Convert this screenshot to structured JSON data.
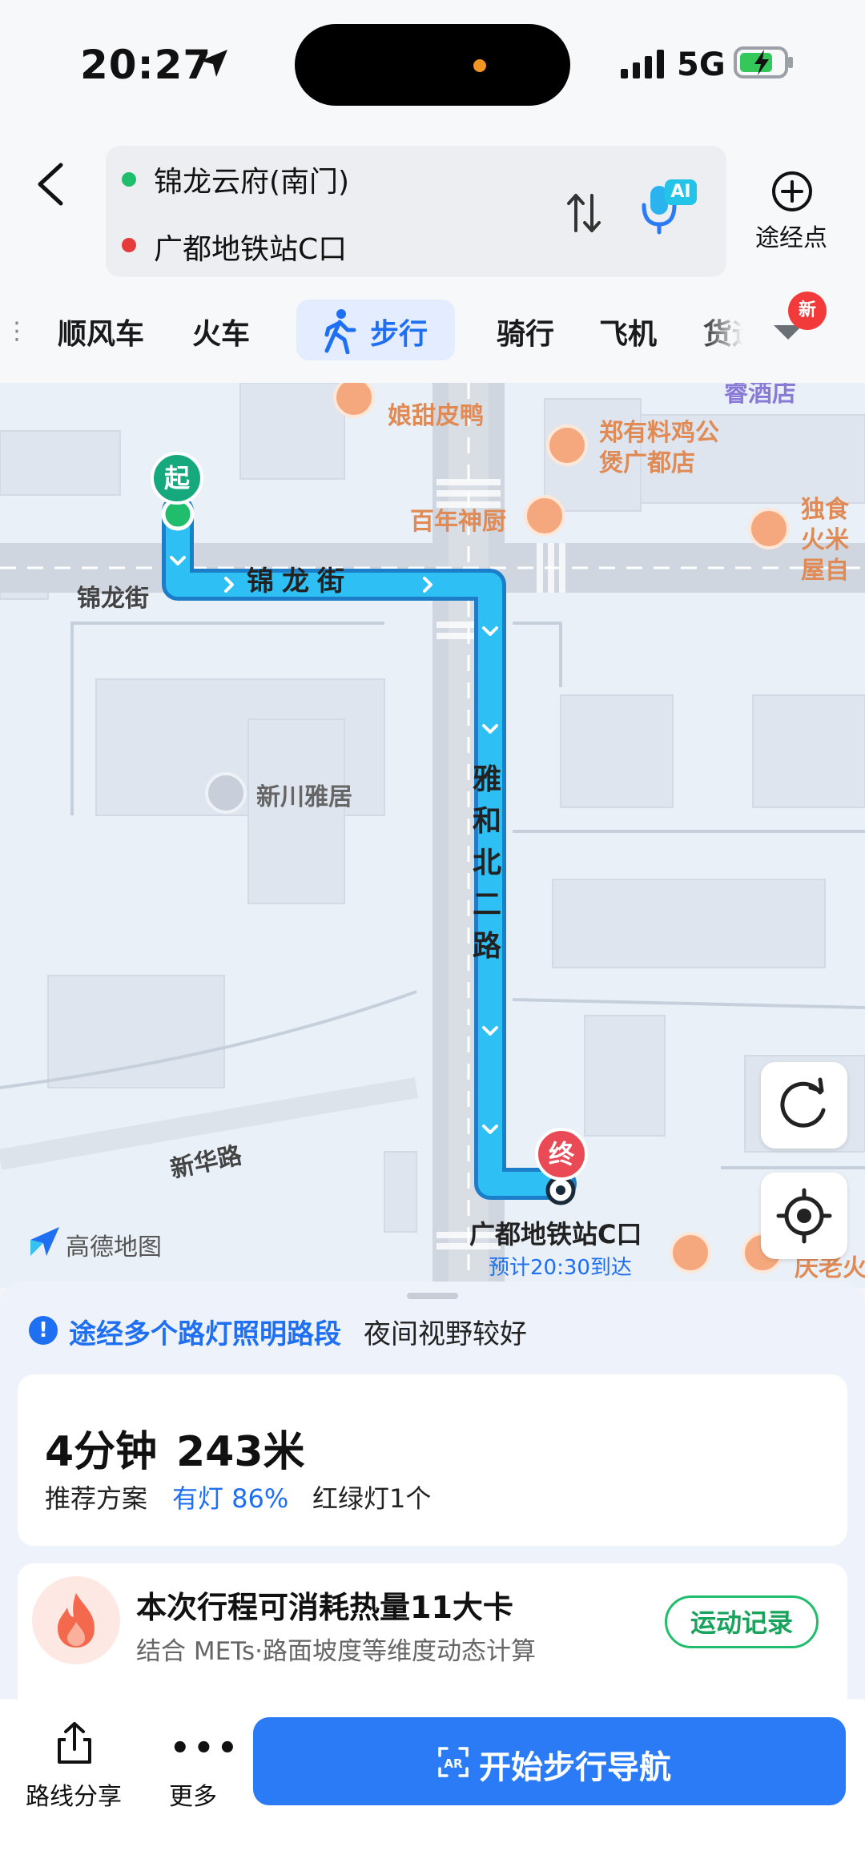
{
  "status_bar": {
    "time": "20:27",
    "network": "5G"
  },
  "route": {
    "origin": "锦龙云府(南门)",
    "destination": "广都地铁站C口",
    "ai_badge": "AI",
    "via_label": "途经点"
  },
  "tabs": {
    "rideshare": "顺风车",
    "train": "火车",
    "walk": "步行",
    "bike": "骑行",
    "plane": "飞机",
    "freight": "货运",
    "new_badge": "新"
  },
  "map": {
    "pois": {
      "sweet_duck": "娘甜皮鸭",
      "zheng_chicken": "郑有料鸡公煲广都店",
      "chef": "百年神厨",
      "duxian": "独食火米屋自",
      "xinchuan": "新川雅居",
      "hotel_partial": "睿酒店"
    },
    "roads": {
      "jinlong_main": "锦龙街",
      "jinlong_side": "锦龙街",
      "yahe": "雅和北二路",
      "xinhua": "新华路"
    },
    "start_marker": "起",
    "end_marker": "终",
    "end_label": "广都地铁站C口",
    "eta": "预计20:30到达",
    "logo": "高德地图",
    "bottom_right_poi": "庆老火"
  },
  "tip": {
    "icon": "!",
    "highlight": "途经多个路灯照明路段",
    "text": "夜间视野较好"
  },
  "summary": {
    "duration": "4分钟",
    "distance": "243米",
    "recommend": "推荐方案",
    "lit": "有灯 86%",
    "traffic_lights": "红绿灯1个"
  },
  "calories": {
    "title": "本次行程可消耗热量11大卡",
    "subtitle": "结合 METs·路面坡度等维度动态计算",
    "button": "运动记录"
  },
  "bottom_bar": {
    "share": "路线分享",
    "more": "更多",
    "start": "开始步行导航",
    "more_icon": "•••"
  },
  "colors": {
    "accent_blue": "#2b7bf7",
    "route_cyan": "#20b8f0",
    "origin_green": "#1fbd6c",
    "dest_red": "#e63b3b"
  }
}
